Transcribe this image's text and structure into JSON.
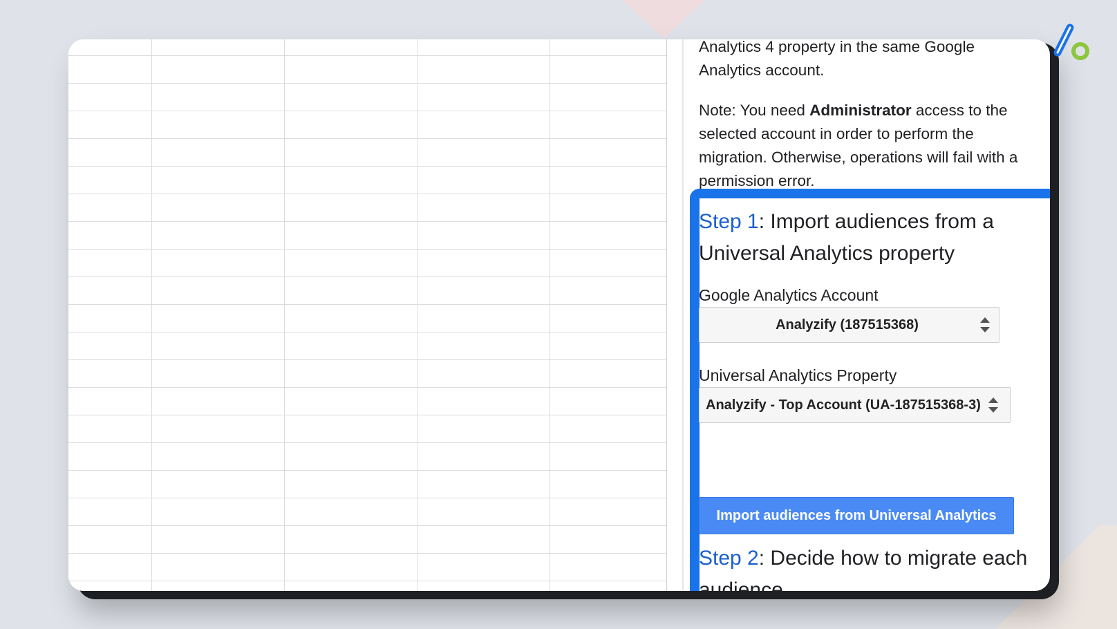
{
  "panel": {
    "intro_line1": "Analytics 4 property in the same Google",
    "intro_line2": "Analytics account.",
    "note_prefix": "Note: You need ",
    "note_bold": "Administrator",
    "note_suffix": " access to the",
    "note_line2": "selected account in order to perform the",
    "note_line3": "migration. Otherwise, operations will fail with a",
    "note_line4": "permission error."
  },
  "step1": {
    "link": "Step 1",
    "title_part1": ": Import audiences from a",
    "title_part2": "Universal Analytics property",
    "account_label": "Google Analytics Account",
    "account_value": "Analyzify (187515368)",
    "property_label": "Universal Analytics Property",
    "property_value": "Analyzify - Top Account (UA-187515368-3)",
    "import_button": "Import audiences from Universal Analytics"
  },
  "step2": {
    "link": "Step 2",
    "title_part1": ": Decide how to migrate each",
    "title_part2": "audience"
  },
  "colors": {
    "accent_blue": "#1a73e8",
    "button_blue": "#4a8af4",
    "step_link_blue": "#1a5fcf",
    "logo_blue": "#1a73e8",
    "logo_green": "#8dc63f"
  },
  "icons": {
    "select_arrows": "sort-updown-icon",
    "brand_logo": "analyzify-logo"
  }
}
